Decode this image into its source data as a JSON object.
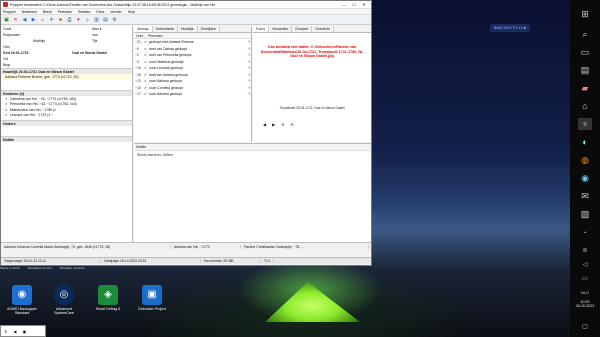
{
  "window": {
    "title": "Proppen bestanden\\ C:\\Gene-kosmos\\Familie van Doorenthal-Ars Geslachtlijn 23:37:38:16:48:38:2023 genealogie - Matthijs van Hei",
    "controls": [
      "—",
      "☐",
      "✕"
    ]
  },
  "menu": [
    "Proppen",
    "Bewerken",
    "Beeld",
    "Personen",
    "Relaties",
    "Extra",
    "Venster",
    "Help"
  ],
  "person": {
    "fields": [
      {
        "label": "Code",
        "value": "",
        "value2": "Man ▾"
      },
      {
        "label": "Roepnaam",
        "value": "",
        "value2": "van"
      },
      {
        "label": "",
        "value": "Matthijs",
        "value2": "Tijs"
      },
      {
        "label": "Geb",
        "value": "",
        "value2": ""
      },
      {
        "label": "Ged 29-01-1721",
        "value": "",
        "value2": "Oud en Nieuw Gastel"
      },
      {
        "label": "Ovl",
        "value": "",
        "value2": ""
      },
      {
        "label": "Begr",
        "value": "",
        "value2": ""
      }
    ],
    "marriage_header": "Huwelijk 20-04-1721 Oud en Nieuw Gastel",
    "spouse": "Adriana Pieterse Broere, geb. 1773 (±1712, Dr)",
    "children_header": "Kinderen (4)",
    "children": [
      "Catharina van Hei, ~43, ~1773 (±1763, ±84)",
      "Petronella van Hei, ~43, ~1773 (±1753, ±44)",
      "Matheuskus van Hei, ~1786 (±",
      "Leonard van Hei, ~1723 (± ~"
    ],
    "section_onders": "Onders",
    "section_notes": "Notitie"
  },
  "events": {
    "tabs": [
      "Verloop",
      "Gebeurtenis",
      "Huwelijk",
      "Overlijden"
    ],
    "list_headers": [
      "Leef...",
      "Personen"
    ],
    "rows": [
      {
        "num": "~21",
        "text": "gedoopt met Adriana Pieterse"
      },
      {
        "num": "~0",
        "text": "doet van Cathaa gedoopt"
      },
      {
        "num": "~2",
        "text": "doet van Petronella gedoopt"
      },
      {
        "num": "~3",
        "text": "zoon Matheus gedoopt"
      },
      {
        "num": "~16",
        "text": "zoon Leonard gedoopt"
      },
      {
        "num": "~18",
        "text": "doet van Adriana gedoopt"
      },
      {
        "num": "~13",
        "text": "zoon Adriana gedoopt"
      },
      {
        "num": "~15",
        "text": "zoon Cornelia gedoopt"
      },
      {
        "num": "~17",
        "text": "zoon Adriana gedoopt"
      }
    ]
  },
  "image_panel": {
    "tabs": [
      "Foto's",
      "Verwanten",
      "Groepen",
      "Overzicht"
    ],
    "message": "Kan bestand niet laden: C:\\Gebruikers\\Familie van Doorenthal\\Matheus\\20-04-1721, Trouwboek 1721-1756, NL Oud en Nieuw Gastel.jpg",
    "footer": "Trouwboek 20-04-1721, Oud en Nieuw Gastel",
    "nav": [
      "◀",
      "▶",
      "✕",
      "⟳"
    ]
  },
  "notes": {
    "header": "Notitie",
    "body": "Wordt-inst/zetel: Ja/Nee"
  },
  "bottombar": [
    "Adriana Johanna Cornelia Maria Gastraptje, 74, geb. 1845 (±1773, 28)",
    "Adriana van Hei, ~1773",
    "Pauline Christiaanse Gastraptje, ~78, ..."
  ],
  "statusbar": [
    "Toegevoegd: 09-01-23 22:11",
    "Gewijzigd: 26-10-2023 23:33",
    "Kw nummer: 29 380",
    "TI-3"
  ],
  "under_strip": [
    "Weiss in beeld",
    "Standaard venster",
    "Bouwlijst: Verkorte"
  ],
  "desktop": {
    "icons": [
      {
        "label": "AOMEI Backupper Standard",
        "color": "#1f6fd1",
        "glyph": "◉"
      },
      {
        "label": "Advanced SystemCare",
        "color": "#0a2a5a",
        "glyph": "◎"
      },
      {
        "label": "Smart Defrag 6",
        "color": "#1c8c3c",
        "glyph": "◈"
      },
      {
        "label": "Gebruiker Project",
        "color": "#1a6fc8",
        "glyph": "▣"
      }
    ],
    "notification": "BAW 30% IT% 13 ■"
  },
  "taskbar": {
    "clock_time": "10:30",
    "clock_date": "26-10-2023",
    "lang": "NLD"
  },
  "mini_window": [
    "✕",
    "◀",
    "▣"
  ],
  "colors": {
    "accent_red": "#e00000",
    "check_green": "#138a13",
    "desktop_sky": "#13204a"
  }
}
